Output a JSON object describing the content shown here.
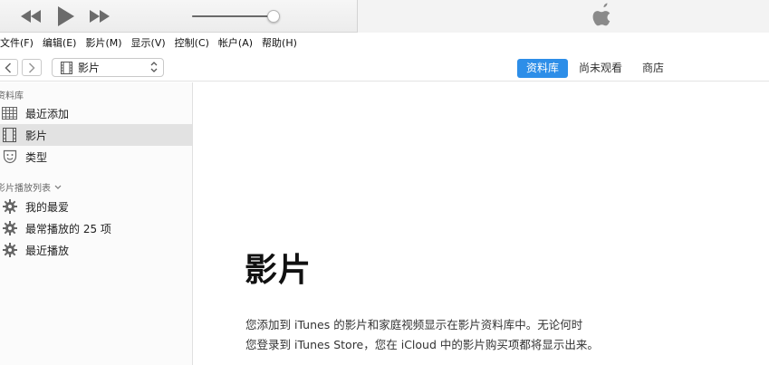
{
  "player": {
    "rewind_icon": "rewind-icon",
    "play_icon": "play-icon",
    "forward_icon": "fast-forward-icon",
    "volume_level": 0.9,
    "logo_icon": "apple-logo-icon"
  },
  "menu": [
    "文件(F)",
    "编辑(E)",
    "影片(M)",
    "显示(V)",
    "控制(C)",
    "帐户(A)",
    "帮助(H)"
  ],
  "toolbar": {
    "media_type": "影片",
    "tabs": [
      {
        "label": "资料库",
        "active": true
      },
      {
        "label": "尚未观看",
        "active": false
      },
      {
        "label": "商店",
        "active": false
      }
    ],
    "accent_color": "#2d8ee8"
  },
  "sidebar": {
    "library_header": "资料库",
    "library_items": [
      {
        "label": "最近添加",
        "icon": "grid-icon"
      },
      {
        "label": "影片",
        "icon": "film-icon",
        "selected": true
      },
      {
        "label": "类型",
        "icon": "theater-masks-icon"
      }
    ],
    "playlists_header": "影片播放列表",
    "playlist_items": [
      {
        "label": "我的最爱",
        "icon": "gear-icon"
      },
      {
        "label": "最常播放的 25 项",
        "icon": "gear-icon"
      },
      {
        "label": "最近播放",
        "icon": "gear-icon"
      }
    ]
  },
  "main": {
    "title": "影片",
    "description_line1": "您添加到 iTunes 的影片和家庭视频显示在影片资料库中。无论何时",
    "description_line2": "您登录到 iTunes Store，您在 iCloud 中的影片购买项都将显示出来。"
  }
}
